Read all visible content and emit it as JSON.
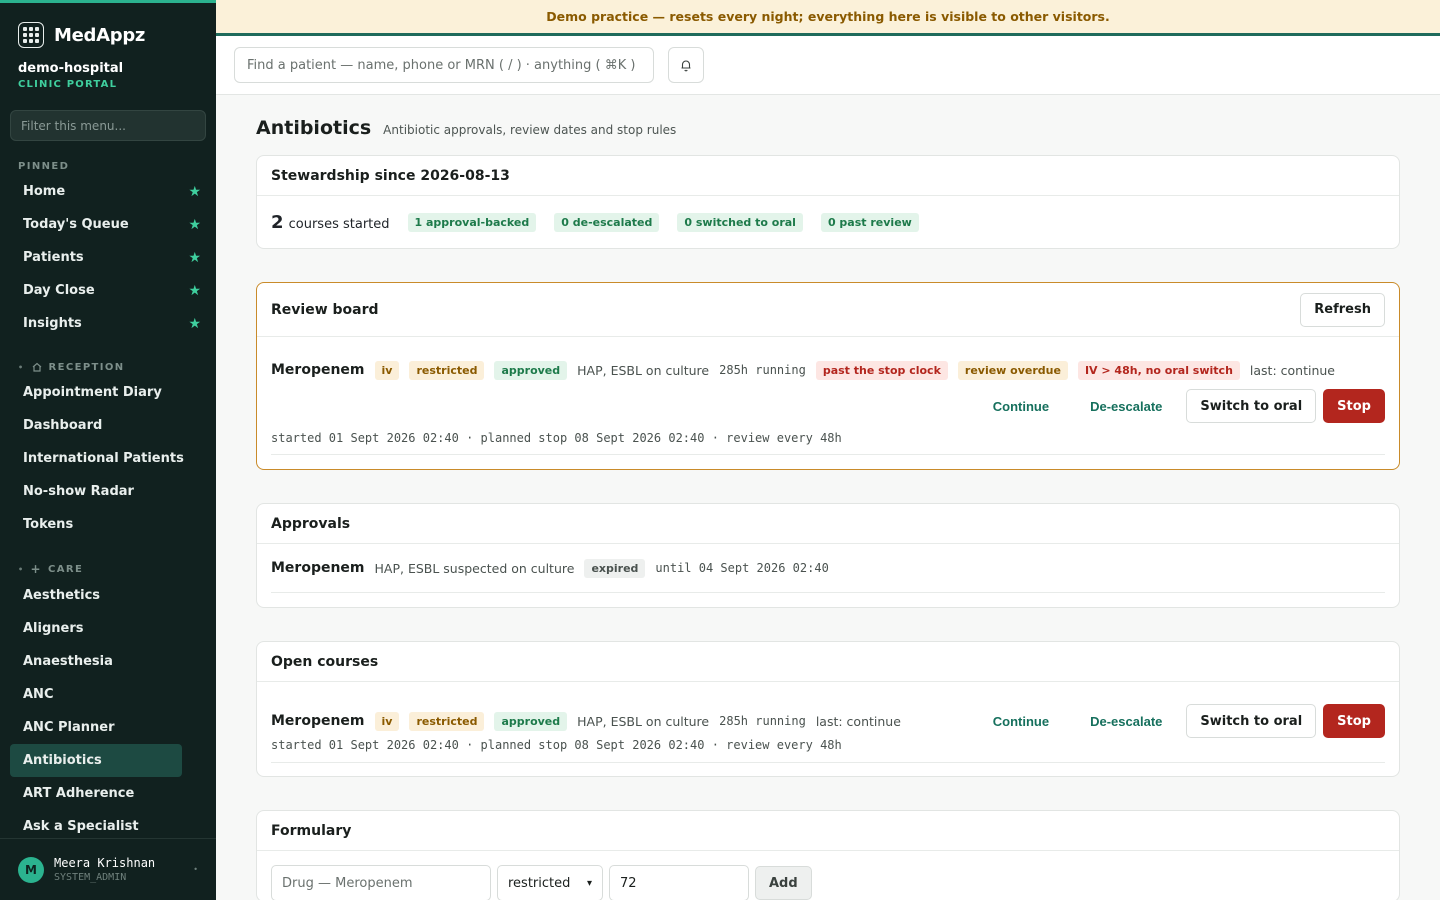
{
  "brand": {
    "name": "MedAppz",
    "org": "demo-hospital",
    "org_sub": "CLINIC PORTAL"
  },
  "sidebar": {
    "filter_placeholder": "Filter this menu...",
    "pinned_label": "PINNED",
    "pinned": [
      {
        "label": "Home"
      },
      {
        "label": "Today's Queue"
      },
      {
        "label": "Patients"
      },
      {
        "label": "Day Close"
      },
      {
        "label": "Insights"
      }
    ],
    "reception_label": "RECEPTION",
    "reception": [
      {
        "label": "Appointment Diary"
      },
      {
        "label": "Dashboard"
      },
      {
        "label": "International Patients"
      },
      {
        "label": "No-show Radar"
      },
      {
        "label": "Tokens"
      }
    ],
    "care_label": "CARE",
    "care": [
      {
        "label": "Aesthetics"
      },
      {
        "label": "Aligners"
      },
      {
        "label": "Anaesthesia"
      },
      {
        "label": "ANC"
      },
      {
        "label": "ANC Planner"
      },
      {
        "label": "Antibiotics"
      },
      {
        "label": "ART Adherence"
      },
      {
        "label": "Ask a Specialist"
      }
    ],
    "active": "Antibiotics",
    "user": {
      "initial": "M",
      "name": "Meera Krishnan",
      "role": "SYSTEM_ADMIN"
    }
  },
  "banner": "Demo practice — resets every night; everything here is visible to other visitors.",
  "topbar": {
    "search_placeholder": "Find a patient — name, phone or MRN ( / ) · anything ( ⌘K )"
  },
  "page": {
    "title": "Antibiotics",
    "subtitle": "Antibiotic approvals, review dates and stop rules"
  },
  "stewardship": {
    "title": "Stewardship since 2026-08-13",
    "count": "2",
    "count_label": "courses started",
    "badges": [
      "1 approval-backed",
      "0 de-escalated",
      "0 switched to oral",
      "0 past review"
    ]
  },
  "review_board": {
    "title": "Review board",
    "refresh": "Refresh",
    "drug": "Meropenem",
    "tags": [
      "iv",
      "restricted",
      "approved"
    ],
    "indication": "HAP, ESBL on culture",
    "running": "285h running",
    "alerts": [
      "past the stop clock",
      "review overdue",
      "IV > 48h, no oral switch"
    ],
    "last": "last: continue",
    "actions": {
      "continue": "Continue",
      "deescalate": "De-escalate",
      "switch": "Switch to oral",
      "stop": "Stop"
    },
    "timeline": "started 01 Sept 2026 02:40 · planned stop 08 Sept 2026 02:40 · review every 48h"
  },
  "approvals": {
    "title": "Approvals",
    "drug": "Meropenem",
    "indication": "HAP, ESBL suspected on culture",
    "status": "expired",
    "until": "until 04 Sept 2026 02:40"
  },
  "open_courses": {
    "title": "Open courses",
    "drug": "Meropenem",
    "tags": [
      "iv",
      "restricted",
      "approved"
    ],
    "indication": "HAP, ESBL on culture",
    "running": "285h running",
    "last": "last: continue",
    "actions": {
      "continue": "Continue",
      "deescalate": "De-escalate",
      "switch": "Switch to oral",
      "stop": "Stop"
    },
    "timeline": "started 01 Sept 2026 02:40 · planned stop 08 Sept 2026 02:40 · review every 48h"
  },
  "formulary": {
    "title": "Formulary",
    "drug_placeholder": "Drug — Meropenem",
    "class_value": "restricted",
    "hours_value": "72",
    "add": "Add"
  }
}
